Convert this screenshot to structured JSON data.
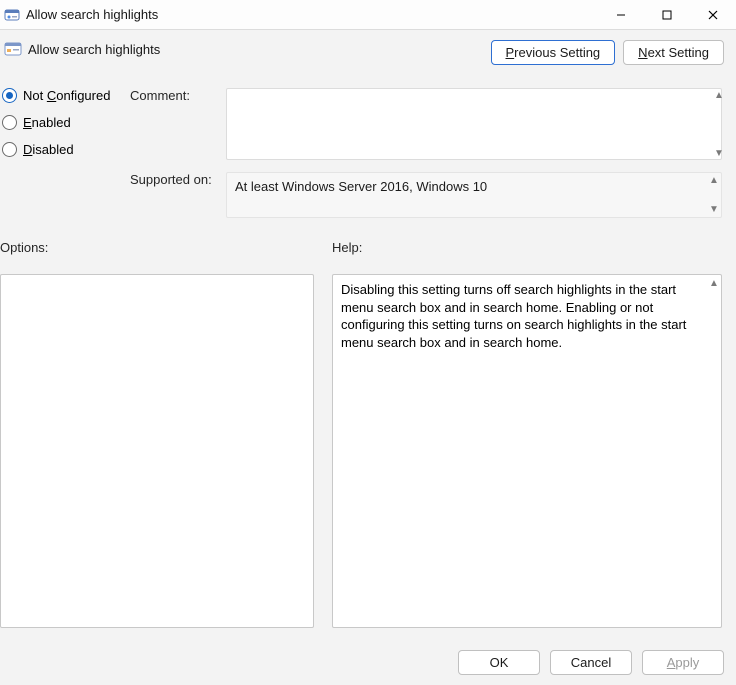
{
  "window": {
    "title": "Allow search highlights",
    "policy_name": "Allow search highlights",
    "buttons": {
      "minimize": "–",
      "maximize": "□",
      "close": "✕"
    }
  },
  "nav": {
    "previous_pre": "",
    "previous_accel": "P",
    "previous_post": "revious Setting",
    "next_pre": "",
    "next_accel": "N",
    "next_post": "ext Setting"
  },
  "radios": {
    "not_configured_pre": "Not ",
    "not_configured_accel": "C",
    "not_configured_post": "onfigured",
    "enabled_accel": "E",
    "enabled_post": "nabled",
    "disabled_accel": "D",
    "disabled_post": "isabled"
  },
  "labels": {
    "comment": "Comment:",
    "supported_on": "Supported on:",
    "options": "Options:",
    "help": "Help:"
  },
  "fields": {
    "comment_value": "",
    "supported_on_value": "At least Windows Server 2016, Windows 10",
    "help_text": "Disabling this setting turns off search highlights in the start menu search box and in search home. Enabling or not configuring this setting turns on search highlights in the start menu search box and in search home."
  },
  "footer": {
    "ok": "OK",
    "cancel": "Cancel",
    "apply_accel": "A",
    "apply_post": "pply"
  },
  "glyphs": {
    "tri_up": "▲",
    "tri_down": "▼"
  }
}
